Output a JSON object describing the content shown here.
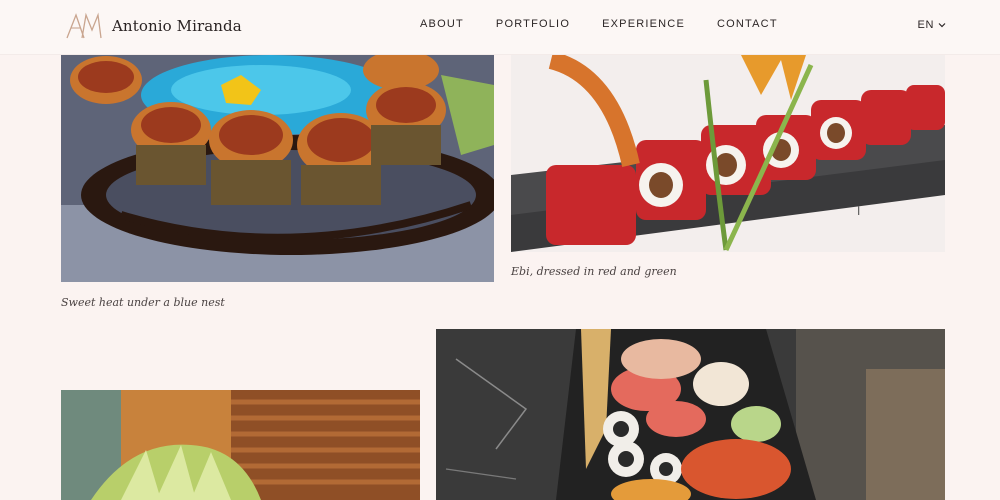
{
  "brand": {
    "mark": "AM",
    "name": "Antonio Miranda"
  },
  "nav": [
    {
      "label": "ABOUT"
    },
    {
      "label": "PORTFOLIO"
    },
    {
      "label": "EXPERIENCE"
    },
    {
      "label": "CONTACT"
    }
  ],
  "language": {
    "current": "EN",
    "icon": "chevron-down-icon"
  },
  "gallery": {
    "items": [
      {
        "caption": "Sweet heat under a blue nest"
      },
      {
        "caption": "Ebi, dressed in red and green"
      },
      {
        "caption": ""
      },
      {
        "caption": ""
      }
    ]
  },
  "colors": {
    "background": "#fbf3f1",
    "accent": "#c9a58f",
    "text": "#2c2626"
  }
}
